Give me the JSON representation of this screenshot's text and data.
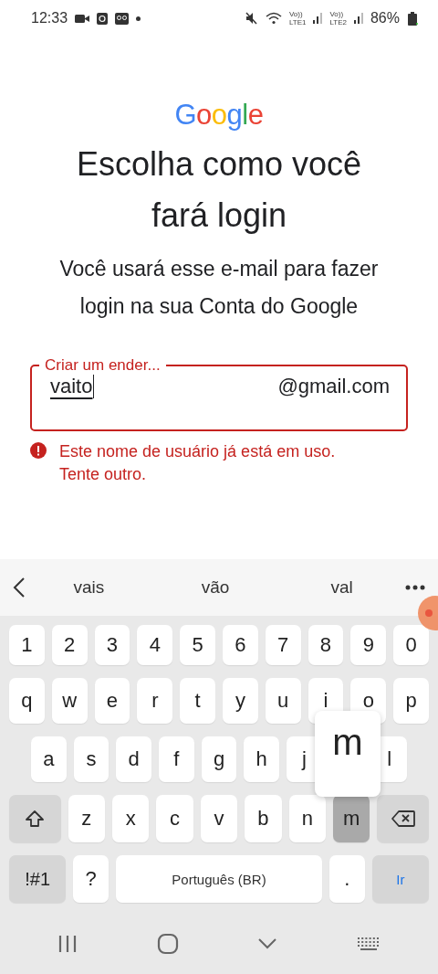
{
  "status_bar": {
    "time": "12:33",
    "signals": [
      {
        "top": "Vo))",
        "bottom": "LTE1"
      },
      {
        "top": "Vo))",
        "bottom": "LTE2"
      }
    ],
    "battery": "86%"
  },
  "logo": "Google",
  "title": "Escolha como você fará login",
  "subtitle": "Você usará esse e-mail para fazer login na sua Conta do Google",
  "email_field": {
    "label": "Criar um ender...",
    "value": "vaito",
    "suffix": "@gmail.com",
    "error": true
  },
  "error_message": "Este nome de usuário já está em uso. Tente outro.",
  "suggestions": [
    "vais",
    "vão",
    "val"
  ],
  "keyboard": {
    "rows": [
      {
        "keys": [
          {
            "label": "1",
            "kind": "letter",
            "pressed": false
          },
          {
            "label": "2",
            "kind": "letter",
            "pressed": false
          },
          {
            "label": "3",
            "kind": "letter",
            "pressed": false
          },
          {
            "label": "4",
            "kind": "letter",
            "pressed": false
          },
          {
            "label": "5",
            "kind": "letter",
            "pressed": false
          },
          {
            "label": "6",
            "kind": "letter",
            "pressed": false
          },
          {
            "label": "7",
            "kind": "letter",
            "pressed": false
          },
          {
            "label": "8",
            "kind": "letter",
            "pressed": false
          },
          {
            "label": "9",
            "kind": "letter",
            "pressed": false
          },
          {
            "label": "0",
            "kind": "letter",
            "pressed": false
          }
        ]
      },
      {
        "keys": [
          {
            "label": "q",
            "kind": "letter",
            "pressed": false
          },
          {
            "label": "w",
            "kind": "letter",
            "pressed": false
          },
          {
            "label": "e",
            "kind": "letter",
            "pressed": false
          },
          {
            "label": "r",
            "kind": "letter",
            "pressed": false
          },
          {
            "label": "t",
            "kind": "letter",
            "pressed": false
          },
          {
            "label": "y",
            "kind": "letter",
            "pressed": false
          },
          {
            "label": "u",
            "kind": "letter",
            "pressed": false
          },
          {
            "label": "i",
            "kind": "letter",
            "pressed": false
          },
          {
            "label": "o",
            "kind": "letter",
            "pressed": false
          },
          {
            "label": "p",
            "kind": "letter",
            "pressed": false
          }
        ]
      },
      {
        "keys": [
          {
            "label": "a",
            "kind": "letter",
            "pressed": false
          },
          {
            "label": "s",
            "kind": "letter",
            "pressed": false
          },
          {
            "label": "d",
            "kind": "letter",
            "pressed": false
          },
          {
            "label": "f",
            "kind": "letter",
            "pressed": false
          },
          {
            "label": "g",
            "kind": "letter",
            "pressed": false
          },
          {
            "label": "h",
            "kind": "letter",
            "pressed": false
          },
          {
            "label": "j",
            "kind": "letter",
            "pressed": false
          },
          {
            "kind": "hidden"
          },
          {
            "label": "l",
            "kind": "letter",
            "pressed": false
          }
        ]
      },
      {
        "keys": [
          {
            "kind": "shift"
          },
          {
            "label": "z",
            "kind": "letter",
            "pressed": false
          },
          {
            "label": "x",
            "kind": "letter",
            "pressed": false
          },
          {
            "label": "c",
            "kind": "letter",
            "pressed": false
          },
          {
            "label": "v",
            "kind": "letter",
            "pressed": false
          },
          {
            "label": "b",
            "kind": "letter",
            "pressed": false
          },
          {
            "label": "n",
            "kind": "letter",
            "pressed": false
          },
          {
            "label": "m",
            "kind": "letter",
            "pressed": true
          },
          {
            "kind": "backspace"
          }
        ]
      },
      {
        "keys": [
          {
            "label": "!#1",
            "kind": "function"
          },
          {
            "label": "?",
            "kind": "letter",
            "pressed": false
          },
          {
            "label": "Português (BR)",
            "kind": "space"
          },
          {
            "label": ".",
            "kind": "letter",
            "pressed": false
          },
          {
            "label": "Ir",
            "kind": "action"
          }
        ]
      }
    ],
    "preview": "m"
  }
}
